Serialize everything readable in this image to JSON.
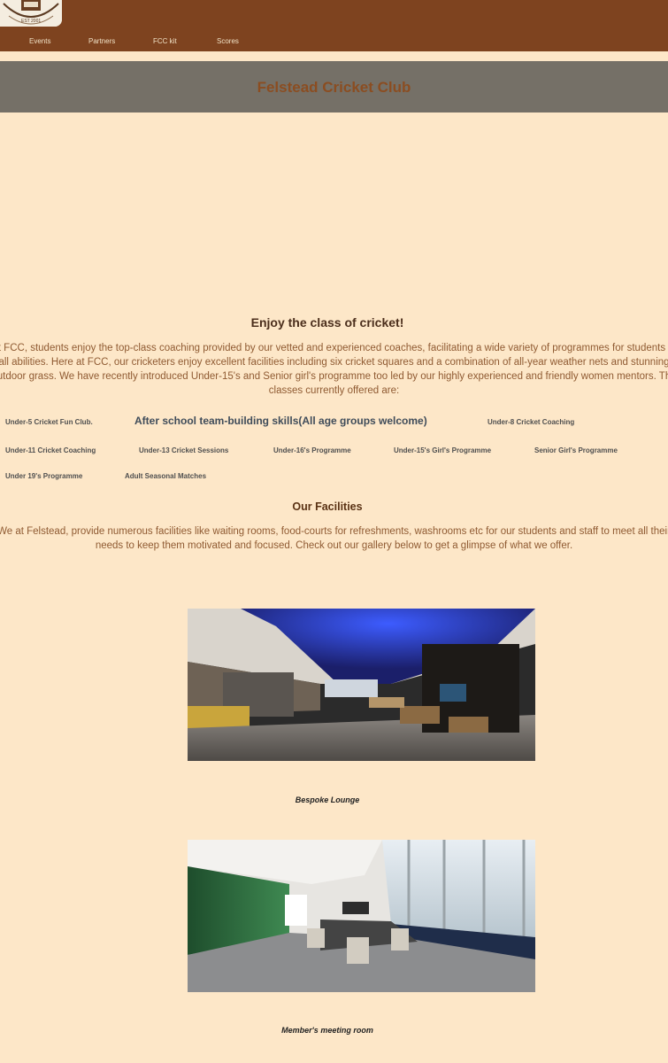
{
  "nav": {
    "items": [
      {
        "label": "Events"
      },
      {
        "label": "Partners"
      },
      {
        "label": "FCC kit"
      },
      {
        "label": "Scores"
      }
    ]
  },
  "banner": {
    "title": "Felstead Cricket Club"
  },
  "intro": {
    "heading": "Enjoy the class of cricket!",
    "paragraph": "At FCC, students enjoy the top-class coaching provided by our vetted and experienced coaches, facilitating a wide variety of programmes for students of all abilities. Here at FCC, our cricketers enjoy excellent facilities including six cricket squares and a combination of all-year weather nets and stunning outdoor grass. We have recently introduced Under-15's and Senior girl's programme too led by our highly experienced and friendly women mentors. The classes currently offered are:"
  },
  "programmes": [
    "Under-5 Cricket Fun Club.",
    "After school team-building skills(All age groups welcome)",
    "Under-8 Cricket Coaching",
    "Under-11 Cricket Coaching",
    "Under-13 Cricket Sessions",
    "Under-16's Programme",
    "Under-15's Girl's Programme",
    "Senior Girl's Programme",
    "Under 19's Programme",
    "Adult Seasonal Matches"
  ],
  "facilities": {
    "heading": "Our Facilities",
    "paragraph": "We at Felstead, provide numerous facilities like waiting rooms, food-courts for refreshments, washrooms etc for our students and staff to meet all their needs to keep them motivated and focused. Check out our gallery below to get a glimpse of what we offer."
  },
  "gallery": [
    {
      "caption": "Bespoke Lounge"
    },
    {
      "caption": "Member's meeting room"
    }
  ],
  "colors": {
    "page_bg": "#fde7c8",
    "nav_bg": "#7e431f",
    "banner_bg": "#757067",
    "title_color": "#8b4d21"
  }
}
